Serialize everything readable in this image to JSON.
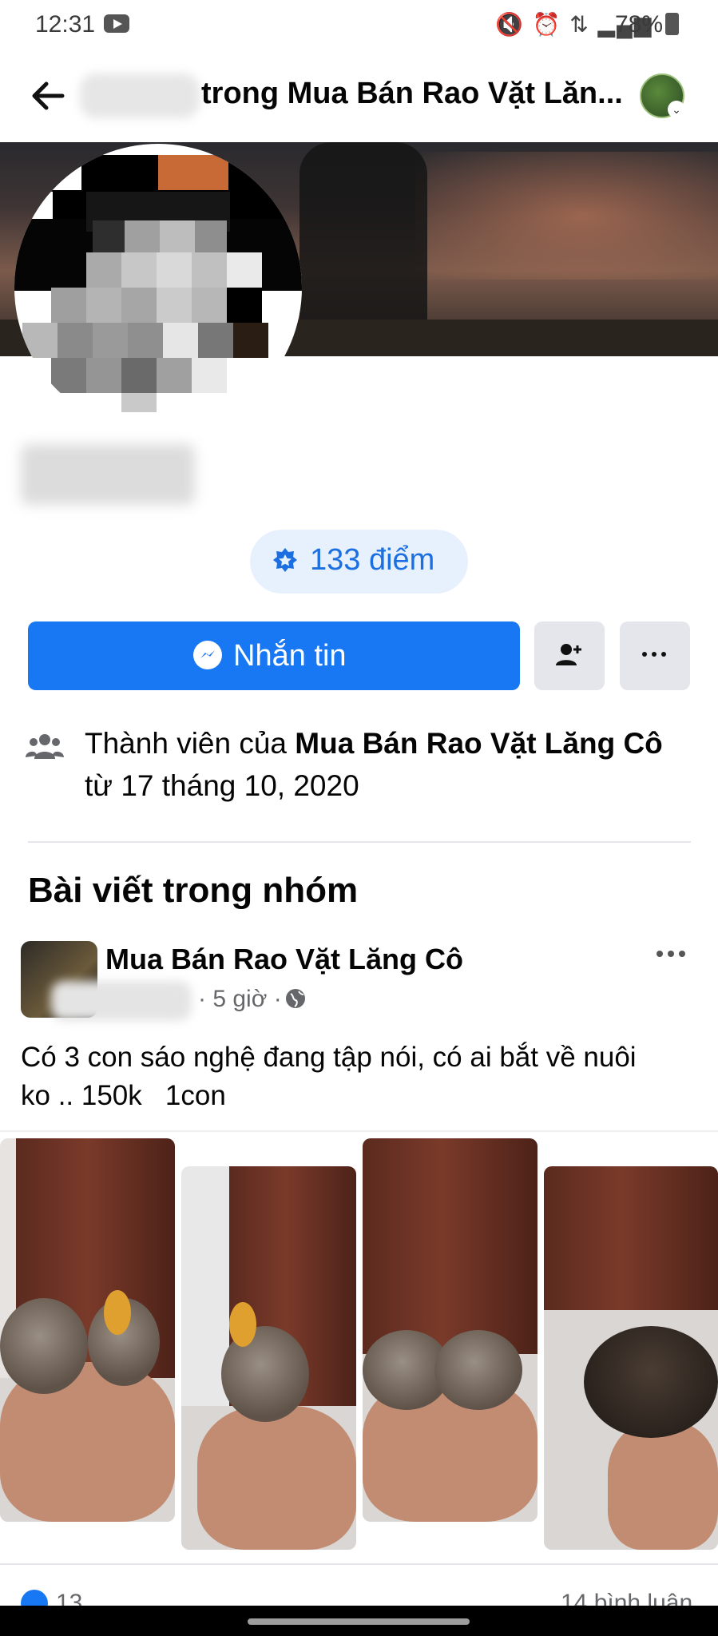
{
  "status_bar": {
    "time": "12:31",
    "battery": "78%"
  },
  "header": {
    "title": "trong Mua Bán Rao Vặt Lăn..."
  },
  "points": {
    "text": "133 điểm"
  },
  "actions": {
    "message_label": "Nhắn tin"
  },
  "membership": {
    "prefix": "Thành viên của ",
    "group": "Mua Bán Rao Vặt Lăng Cô",
    "since": "từ 17 tháng 10, 2020"
  },
  "section": {
    "title": "Bài viết trong nhóm"
  },
  "post": {
    "group": "Mua Bán Rao Vặt Lăng Cô",
    "time": "· 5 giờ ·",
    "text": "Có 3 con sáo nghệ đang tập nói, có ai bắt về nuôi\nko .. 150k   1con",
    "likes": "13",
    "comments": "14 bình luận"
  },
  "colors": {
    "accent": "#1877f2",
    "badge_bg": "#e7f1fd",
    "badge_text": "#1b6fe0"
  }
}
